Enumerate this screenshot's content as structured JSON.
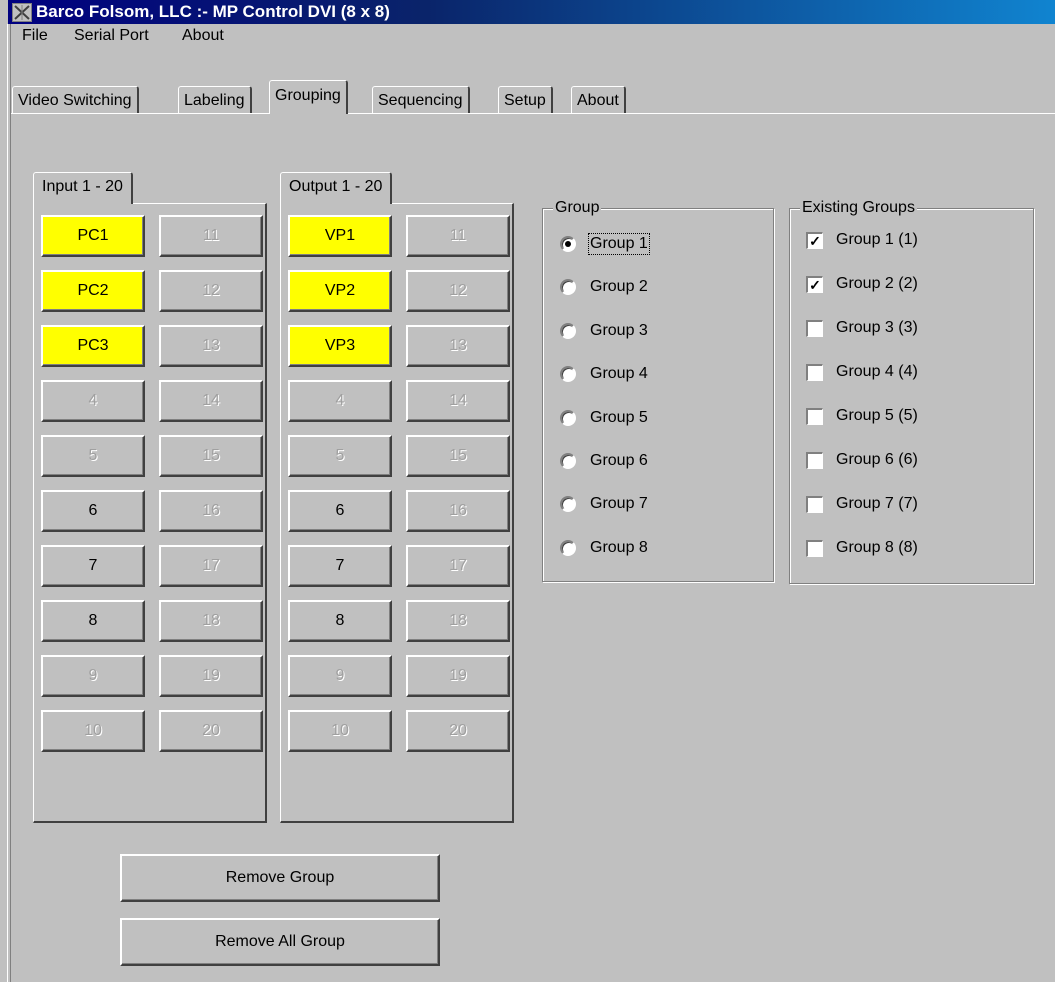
{
  "window": {
    "title": "Barco Folsom, LLC :- MP Control DVI (8 x 8)"
  },
  "menu": [
    "File",
    "Serial Port",
    "About"
  ],
  "tabs": [
    "Video Switching",
    "Labeling",
    "Grouping",
    "Sequencing",
    "Setup",
    "About"
  ],
  "active_tab": "Grouping",
  "input_panel": {
    "tab_label": "Input 1 - 20",
    "col1": [
      "PC1",
      "PC2",
      "PC3",
      "4",
      "5",
      "6",
      "7",
      "8",
      "9",
      "10"
    ],
    "col2": [
      "11",
      "12",
      "13",
      "14",
      "15",
      "16",
      "17",
      "18",
      "19",
      "20"
    ]
  },
  "output_panel": {
    "tab_label": "Output 1 - 20",
    "col1": [
      "VP1",
      "VP2",
      "VP3",
      "4",
      "5",
      "6",
      "7",
      "8",
      "9",
      "10"
    ],
    "col2": [
      "11",
      "12",
      "13",
      "14",
      "15",
      "16",
      "17",
      "18",
      "19",
      "20"
    ]
  },
  "button_states": {
    "col1": [
      "yellow",
      "yellow",
      "yellow",
      "disabled",
      "disabled",
      "normal",
      "normal",
      "normal",
      "disabled",
      "disabled"
    ],
    "col2": [
      "disabled",
      "disabled",
      "disabled",
      "disabled",
      "disabled",
      "disabled",
      "disabled",
      "disabled",
      "disabled",
      "disabled"
    ]
  },
  "colors": {
    "highlight": "#ffff00",
    "titlebar": "#000080"
  },
  "group_box": {
    "legend": "Group",
    "options": [
      "Group 1",
      "Group 2",
      "Group 3",
      "Group 4",
      "Group 5",
      "Group 6",
      "Group 7",
      "Group 8"
    ],
    "selected": "Group 1"
  },
  "existing_groups": {
    "legend": "Existing Groups",
    "items": [
      {
        "label": "Group 1 (1)",
        "checked": true
      },
      {
        "label": "Group 2 (2)",
        "checked": true
      },
      {
        "label": "Group 3 (3)",
        "checked": false
      },
      {
        "label": "Group 4 (4)",
        "checked": false
      },
      {
        "label": "Group 5 (5)",
        "checked": false
      },
      {
        "label": "Group 6 (6)",
        "checked": false
      },
      {
        "label": "Group 7 (7)",
        "checked": false
      },
      {
        "label": "Group 8 (8)",
        "checked": false
      }
    ]
  },
  "actions": {
    "remove_group": "Remove Group",
    "remove_all_group": "Remove All Group"
  }
}
